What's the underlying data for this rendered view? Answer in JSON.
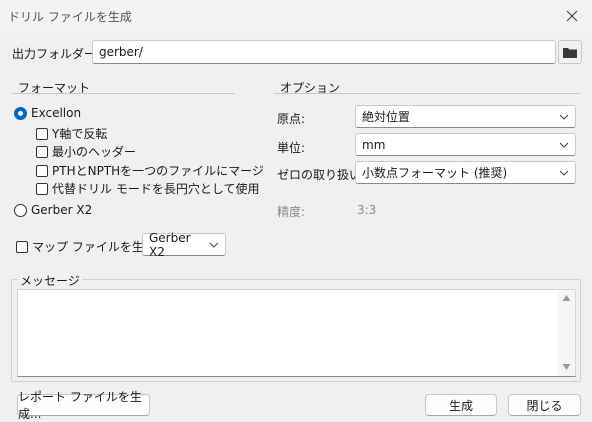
{
  "window": {
    "title": "ドリル ファイルを生成"
  },
  "output": {
    "label": "出力フォルダー:",
    "value": "gerber/"
  },
  "format": {
    "heading": "フォーマット",
    "excellon_label": "Excellon",
    "excellon_selected": true,
    "options": [
      {
        "label": "Y軸で反転",
        "checked": false
      },
      {
        "label": "最小のヘッダー",
        "checked": false
      },
      {
        "label": "PTHとNPTHを一つのファイルにマージ",
        "checked": false
      },
      {
        "label": "代替ドリル モードを長円穴として使用",
        "checked": false
      }
    ],
    "gerber_label": "Gerber X2",
    "gerber_selected": false
  },
  "map": {
    "label": "マップ ファイルを生成:",
    "checked": false,
    "selected": "Gerber X2"
  },
  "options": {
    "heading": "オプション",
    "origin_label": "原点:",
    "origin_value": "絶対位置",
    "unit_label": "単位:",
    "unit_value": "mm",
    "zero_label": "ゼロの取り扱い:",
    "zero_value": "小数点フォーマット (推奨)",
    "precision_label": "精度:",
    "precision_value": "3:3"
  },
  "messages": {
    "label": "メッセージ"
  },
  "buttons": {
    "report": "レポート ファイルを生成...",
    "generate": "生成",
    "close": "閉じる"
  },
  "icons": {
    "close": "close-icon",
    "folder": "folder-icon",
    "dropdown": "chevron-down-icon"
  },
  "colors": {
    "accent": "#0067c0"
  }
}
